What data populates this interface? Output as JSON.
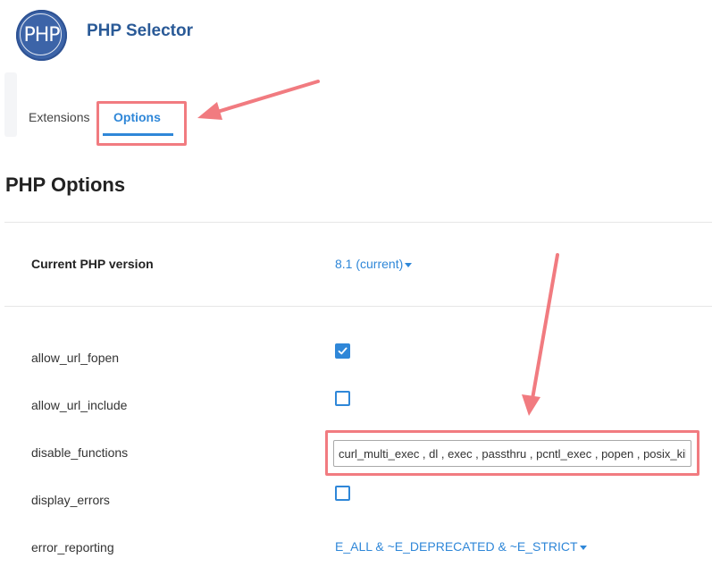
{
  "header": {
    "logo_text": "PHP",
    "title": "PHP Selector"
  },
  "tabs": [
    {
      "label": "Extensions",
      "active": false
    },
    {
      "label": "Options",
      "active": true
    }
  ],
  "section": {
    "title": "PHP Options"
  },
  "version": {
    "label": "Current PHP version",
    "value": "8.1 (current)"
  },
  "options": {
    "allow_url_fopen": {
      "label": "allow_url_fopen",
      "checked": true
    },
    "allow_url_include": {
      "label": "allow_url_include",
      "checked": false
    },
    "disable_functions": {
      "label": "disable_functions",
      "value": "curl_multi_exec , dl , exec , passthru , pcntl_exec , popen , posix_kill , proc_open , shell_exec , show_source , system"
    },
    "display_errors": {
      "label": "display_errors",
      "checked": false
    },
    "error_reporting": {
      "label": "error_reporting",
      "value": "E_ALL & ~E_DEPRECATED & ~E_STRICT"
    }
  },
  "colors": {
    "accent": "#2f87d8",
    "title_blue": "#2a5a97",
    "logo_blue": "#3c64a8",
    "annotation": "#f17b80"
  },
  "icons": {
    "logo": "php-logo-icon",
    "caret": "caret-down-icon",
    "check": "check-icon"
  }
}
